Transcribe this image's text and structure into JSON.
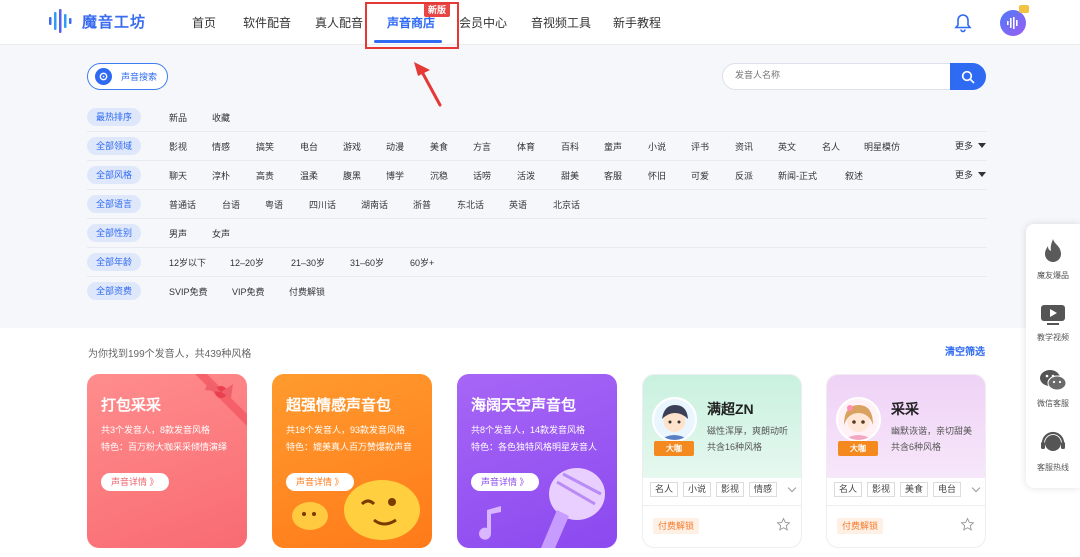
{
  "app": {
    "name": "魔音工坊"
  },
  "nav": {
    "items": [
      {
        "label": "首页"
      },
      {
        "label": "软件配音"
      },
      {
        "label": "真人配音"
      },
      {
        "label": "声音商店",
        "badge": "新版",
        "active": true
      },
      {
        "label": "会员中心"
      },
      {
        "label": "音视频工具"
      },
      {
        "label": "新手教程"
      }
    ]
  },
  "search": {
    "voice_search_label": "声音搜索",
    "placeholder": "发音人名称"
  },
  "filters": {
    "sort": {
      "tag": "最热排序",
      "options": [
        "新品",
        "收藏"
      ]
    },
    "domain": {
      "tag": "全部领域",
      "options": [
        "影视",
        "情感",
        "搞笑",
        "电台",
        "游戏",
        "动漫",
        "美食",
        "方言",
        "体育",
        "百科",
        "童声",
        "小说",
        "评书",
        "资讯",
        "英文",
        "名人",
        "明星模仿"
      ],
      "more": "更多"
    },
    "style": {
      "tag": "全部风格",
      "options": [
        "聊天",
        "淳朴",
        "高贵",
        "温柔",
        "腹黑",
        "博学",
        "沉稳",
        "话唠",
        "活泼",
        "甜美",
        "客服",
        "怀旧",
        "可爱",
        "反派",
        "新闻-正式",
        "叙述"
      ],
      "more": "更多"
    },
    "language": {
      "tag": "全部语言",
      "options": [
        "普通话",
        "台语",
        "粤语",
        "四川话",
        "湖南话",
        "浙普",
        "东北话",
        "英语",
        "北京话"
      ]
    },
    "gender": {
      "tag": "全部性别",
      "options": [
        "男声",
        "女声"
      ]
    },
    "age": {
      "tag": "全部年龄",
      "options": [
        "12岁以下",
        "12–20岁",
        "21–30岁",
        "31–60岁",
        "60岁+"
      ]
    },
    "price": {
      "tag": "全部资费",
      "options": [
        "SVIP免费",
        "VIP免费",
        "付费解锁"
      ]
    }
  },
  "results": {
    "summary": "为你找到199个发音人，共439种风格",
    "clear": "清空筛选"
  },
  "packs": [
    {
      "title": "打包采采",
      "line1": "共3个发音人，8款发音风格",
      "line2": "特色：百万粉大咖采采倾情演绎",
      "button": "声音详情 》"
    },
    {
      "title": "超强情感声音包",
      "line1": "共18个发音人，93款发音风格",
      "line2": "特色：媲美真人百万赞爆款声音",
      "button": "声音详情 》"
    },
    {
      "title": "海阔天空声音包",
      "line1": "共8个发音人，14款发音风格",
      "line2": "特色：各色独特风格明星发音人",
      "button": "声音详情 》"
    }
  ],
  "voices": [
    {
      "name": "满超ZN",
      "badge": "大咖",
      "desc": "磁性浑厚，爽朗动听",
      "styles": "共含16种风格",
      "tags": [
        "名人",
        "小说",
        "影视",
        "情感"
      ],
      "price": "付费解锁"
    },
    {
      "name": "采采",
      "badge": "大咖",
      "desc": "幽默诙谐，亲切甜美",
      "styles": "共含6种风格",
      "tags": [
        "名人",
        "影视",
        "美食",
        "电台"
      ],
      "price": "付费解锁"
    }
  ],
  "sidebar": {
    "items": [
      {
        "label": "魔友爆品"
      },
      {
        "label": "教学视频"
      },
      {
        "label": "微信客服"
      },
      {
        "label": "客服热线"
      }
    ]
  },
  "colors": {
    "primary": "#2f6af2",
    "highlight": "#e53935",
    "badge": "#f48a1f"
  }
}
